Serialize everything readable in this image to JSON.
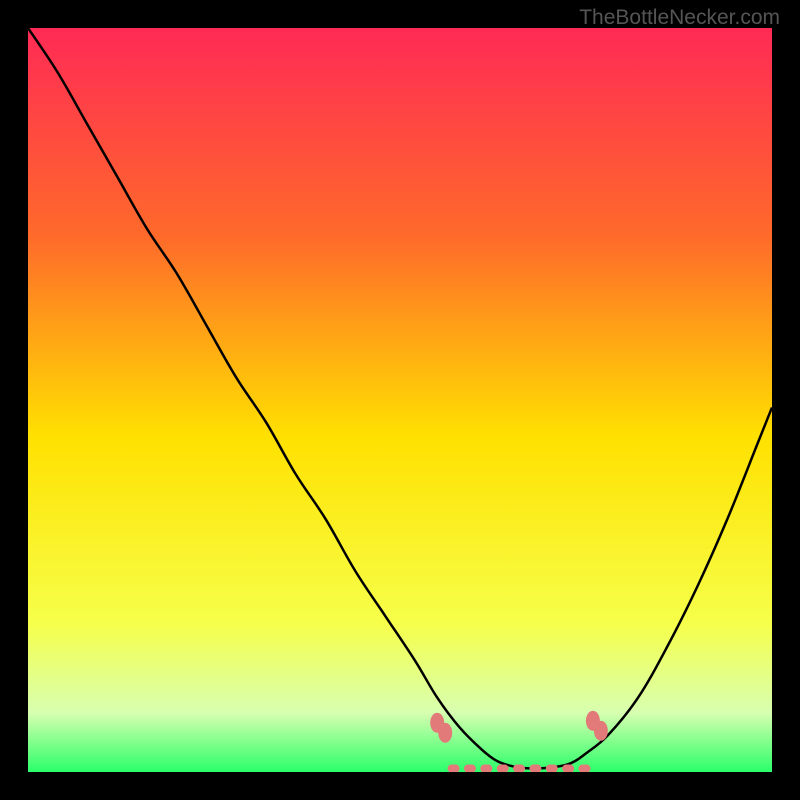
{
  "watermark": "TheBottleNecker.com",
  "chart_data": {
    "type": "line",
    "title": "",
    "xlabel": "",
    "ylabel": "",
    "xlim": [
      0,
      100
    ],
    "ylim": [
      0,
      100
    ],
    "background_gradient": {
      "top": "#ff2a55",
      "mid_upper": "#ff8a2a",
      "mid": "#ffe100",
      "mid_lower": "#f3ff33",
      "bottom": "#2bff6a"
    },
    "series": [
      {
        "name": "bottleneck-curve",
        "x": [
          0,
          4,
          8,
          12,
          16,
          20,
          24,
          28,
          32,
          36,
          40,
          44,
          48,
          52,
          55,
          58,
          61,
          63,
          65,
          67,
          69,
          71,
          73,
          75,
          78,
          82,
          86,
          90,
          94,
          98,
          100
        ],
        "y": [
          100,
          94,
          87,
          80,
          73,
          67,
          60,
          53,
          47,
          40,
          34,
          27,
          21,
          15,
          10,
          6,
          3,
          1.5,
          0.8,
          0.5,
          0.5,
          0.7,
          1.2,
          2.5,
          5,
          10,
          17,
          25,
          34,
          44,
          49
        ]
      }
    ],
    "highlight_band": {
      "name": "optimal-zone",
      "color": "#e37a7a",
      "x_range": [
        55,
        77
      ],
      "y_level": 5
    }
  }
}
